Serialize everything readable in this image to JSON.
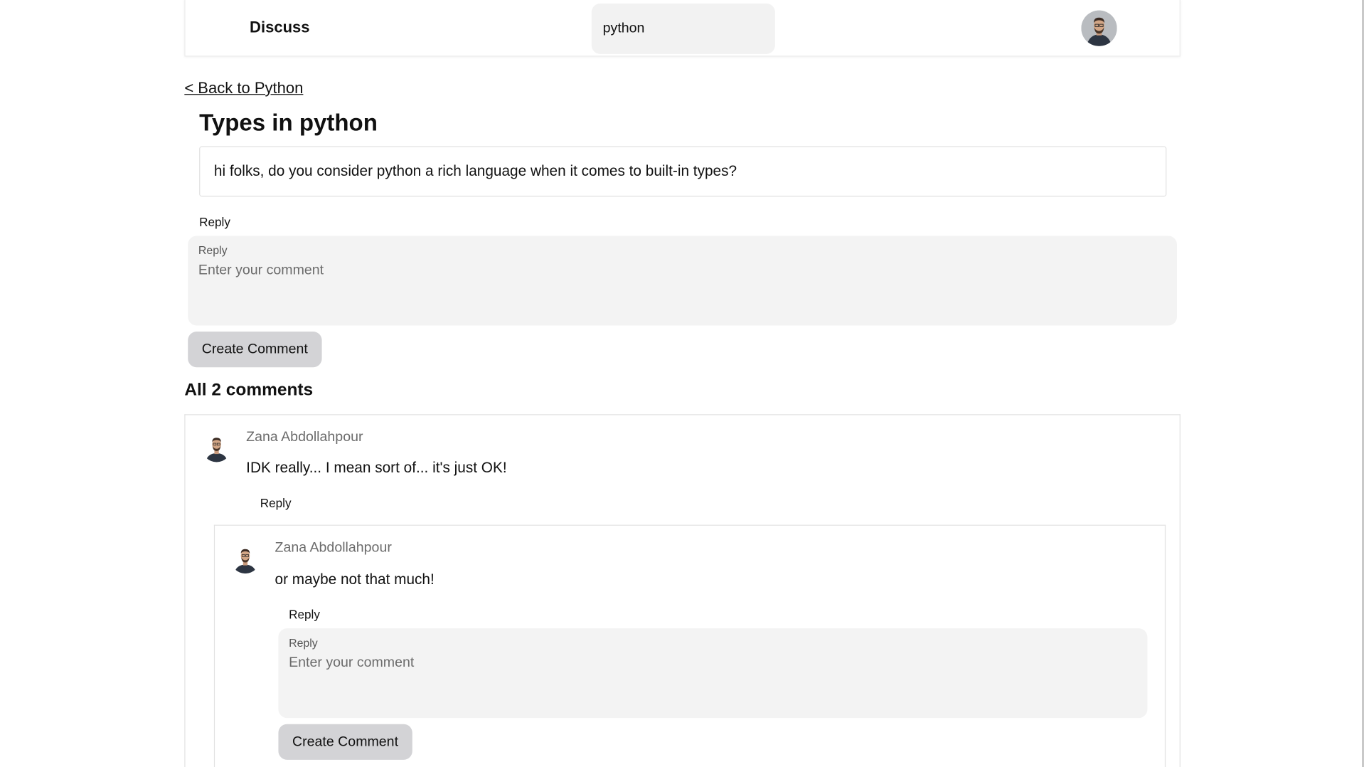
{
  "header": {
    "brand": "Discuss",
    "search_value": "python",
    "avatar_icon": "user-avatar-icon"
  },
  "nav": {
    "back_label": "< Back to Python"
  },
  "post": {
    "title": "Types in python",
    "body": "hi folks, do you consider python a rich language when it comes to built-in types?",
    "reply_label": "Reply"
  },
  "reply_form": {
    "label": "Reply",
    "placeholder": "Enter your comment",
    "button_label": "Create Comment"
  },
  "comments": {
    "heading": "All 2 comments",
    "items": [
      {
        "author": "Zana Abdollahpour",
        "text": "IDK really... I mean sort of... it's just OK!",
        "reply_label": "Reply",
        "children": [
          {
            "author": "Zana Abdollahpour",
            "text": "or maybe not that much!",
            "reply_label": "Reply",
            "reply_form": {
              "label": "Reply",
              "placeholder": "Enter your comment",
              "button_label": "Create Comment"
            }
          }
        ]
      }
    ]
  },
  "colors": {
    "button_bg": "#d3d3d6",
    "input_bg": "#f3f3f3",
    "border": "#e2e2e2",
    "muted_text": "#6b6b6b"
  }
}
